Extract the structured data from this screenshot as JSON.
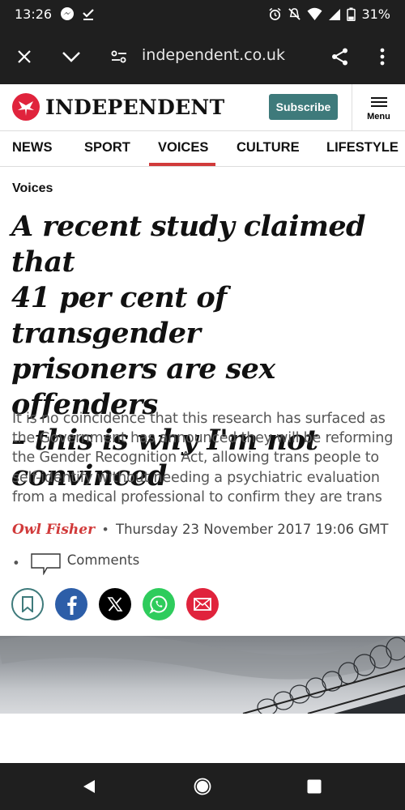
{
  "status": {
    "time": "13:26",
    "battery": "31%"
  },
  "browser": {
    "url": "independent.co.uk"
  },
  "header": {
    "brand": "INDEPENDENT",
    "subscribe_label": "Subscribe",
    "menu_label": "Menu"
  },
  "nav": {
    "items": [
      "NEWS",
      "SPORT",
      "VOICES",
      "CULTURE",
      "LIFESTYLE"
    ],
    "active": "VOICES"
  },
  "article": {
    "section": "Voices",
    "headline_lines": [
      "A recent study claimed that",
      "41 per cent of transgender",
      "prisoners are sex offenders",
      "– this is why I'm not",
      "convinced"
    ],
    "standfirst_lines": [
      "It is no coincidence that this research has surfaced as",
      "the Government has announced they will be reforming",
      "the Gender Recognition Act, allowing trans people to",
      "self-identify without needing a psychiatric evaluation",
      "from a medical professional to confirm they are trans"
    ],
    "author": "Owl Fisher",
    "date": "Thursday 23 November 2017 19:06 GMT",
    "comments_label": "Comments"
  },
  "share": [
    "bookmark-icon",
    "facebook-icon",
    "x-icon",
    "whatsapp-icon",
    "email-icon"
  ],
  "colors": {
    "accent_red": "#d13a3a",
    "subscribe_teal": "#3e7a7b",
    "facebook": "#2d5ea8",
    "whatsapp": "#2ecc5c",
    "email": "#e0233c"
  }
}
